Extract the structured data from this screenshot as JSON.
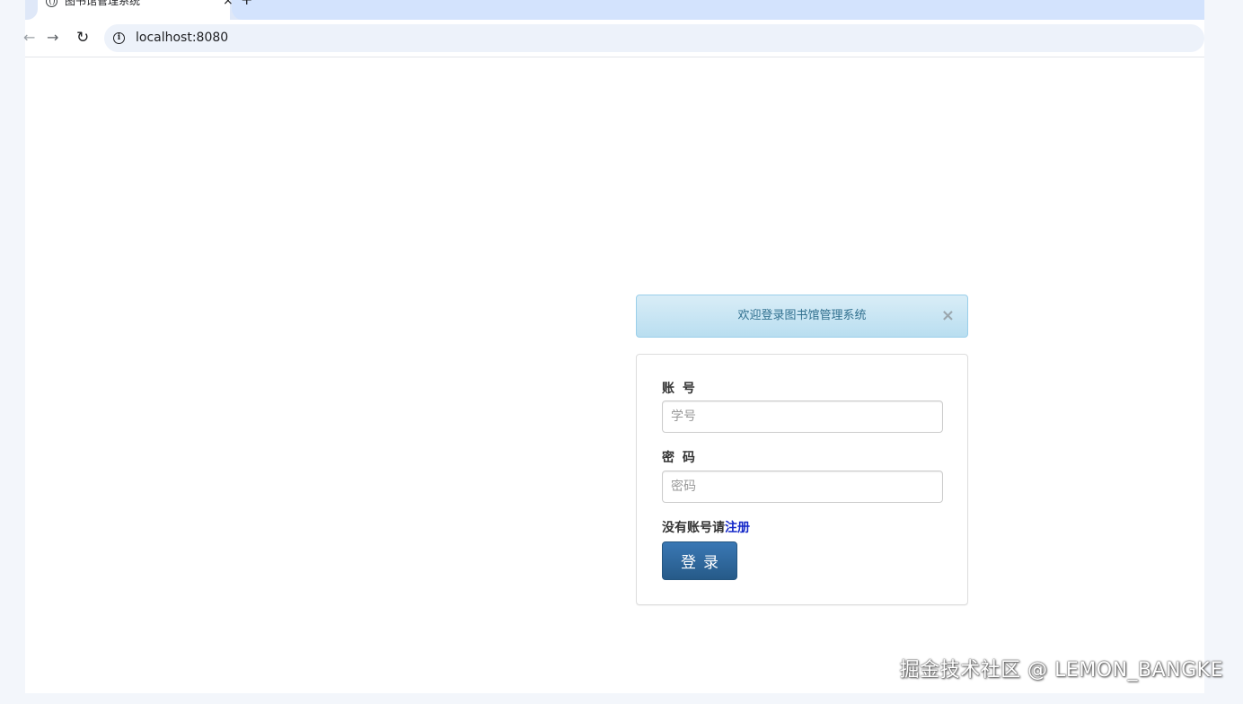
{
  "browser": {
    "tab": {
      "title": "图书馆管理系统",
      "close_glyph": "×",
      "icon": "globe-icon"
    },
    "new_tab_glyph": "+",
    "toolbar": {
      "back_glyph": "←",
      "forward_glyph": "→",
      "reload_glyph": "↻",
      "info_glyph": "i"
    },
    "url": "localhost:8080"
  },
  "alert": {
    "message": "欢迎登录图书馆管理系统",
    "close_glyph": "×"
  },
  "login_form": {
    "account_label": "账 号",
    "account_placeholder": "学号",
    "password_label": "密 码",
    "password_placeholder": "密码",
    "register_prompt": "没有账号请",
    "register_link": "注册",
    "login_button": "登录"
  },
  "watermark": "掘金技术社区 @ LEMON_BANGKE",
  "colors": {
    "alert_bg": "#d9edf7",
    "alert_text": "#31708f",
    "button_primary": "#337ab7",
    "link": "#1428c8"
  }
}
